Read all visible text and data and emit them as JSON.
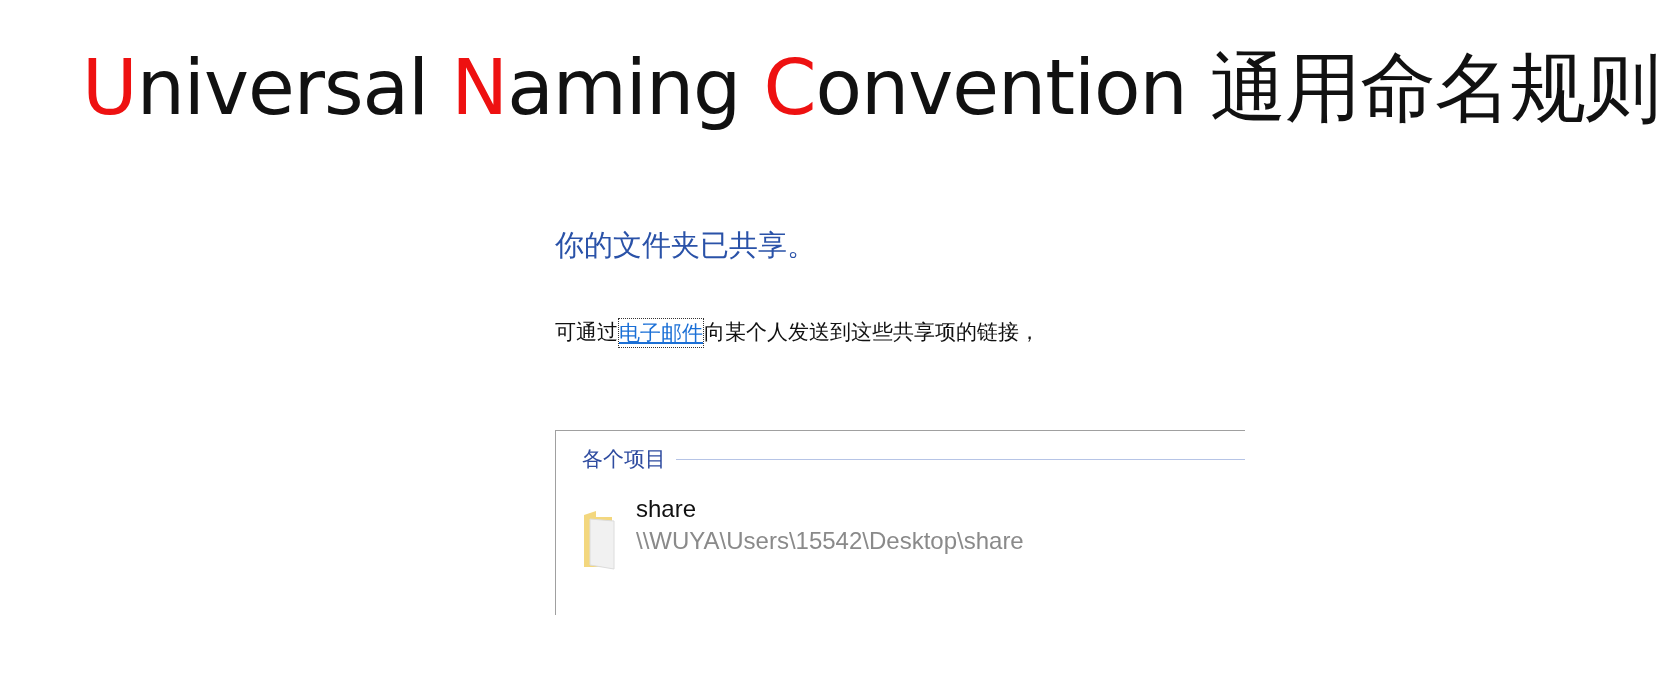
{
  "title": [
    {
      "text": "U",
      "highlight": true
    },
    {
      "text": "niversal ",
      "highlight": false
    },
    {
      "text": "N",
      "highlight": true
    },
    {
      "text": "aming ",
      "highlight": false
    },
    {
      "text": "C",
      "highlight": true
    },
    {
      "text": "onvention 通用命名规则",
      "highlight": false
    }
  ],
  "dialog": {
    "heading": "你的文件夹已共享。",
    "message": {
      "before": "可通过",
      "link": "电子邮件",
      "link_focused": true,
      "after": "向某个人发送到这些共享项的链接，"
    },
    "group": {
      "label": "各个项目",
      "items": [
        {
          "name": "share",
          "path": "\\\\WUYA\\Users\\15542\\Desktop\\share"
        }
      ]
    }
  }
}
